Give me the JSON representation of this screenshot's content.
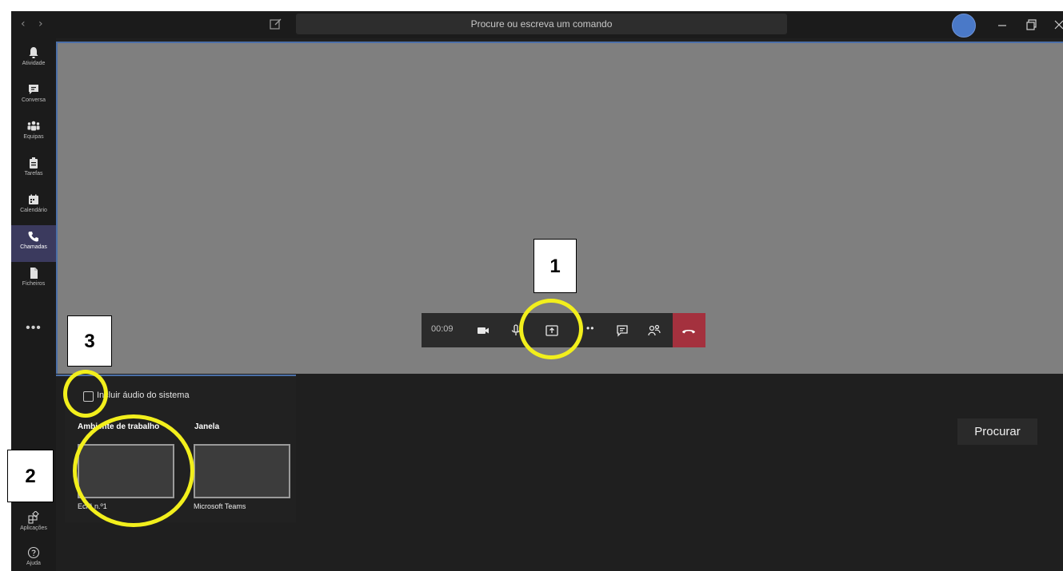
{
  "titlebar": {
    "back_icon": "‹",
    "forward_icon": "›",
    "search_placeholder": "Procure ou escreva um comando"
  },
  "rail": {
    "items": [
      {
        "label": "Atividade",
        "icon": "bell-icon"
      },
      {
        "label": "Conversa",
        "icon": "chat-icon"
      },
      {
        "label": "Equipas",
        "icon": "teams-icon"
      },
      {
        "label": "Tarefas",
        "icon": "tasks-icon"
      },
      {
        "label": "Calendário",
        "icon": "calendar-icon"
      },
      {
        "label": "Chamadas",
        "icon": "phone-icon",
        "active": true
      },
      {
        "label": "Ficheiros",
        "icon": "files-icon"
      }
    ],
    "more": "•••",
    "apps_label": "Aplicações",
    "help_label": "Ajuda"
  },
  "call": {
    "timer": "00:09",
    "more": "••"
  },
  "share": {
    "include_audio_label": "Incluir áudio do sistema",
    "include_audio_checked": false,
    "desktop_label": "Ambiente de trabalho",
    "window_label": "Janela",
    "screen_label": "Ecrã n.º1",
    "window_item_label": "Microsoft Teams",
    "browse_label": "Procurar"
  },
  "annotations": [
    "1",
    "2",
    "3"
  ],
  "colors": {
    "accent": "#4b6fa7",
    "hangup": "#a4313e",
    "highlight": "#f2ef1c",
    "rail_active": "#3b3a5e"
  }
}
